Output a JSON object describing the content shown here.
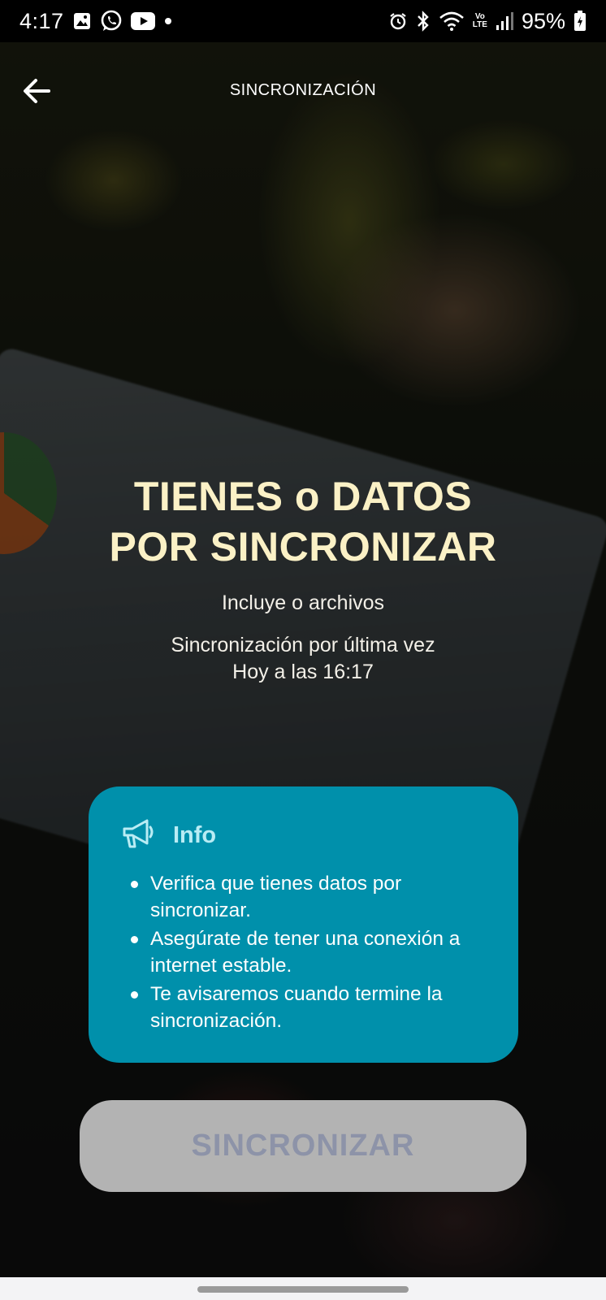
{
  "status_bar": {
    "time": "4:17",
    "battery": "95%",
    "icons_left": [
      "gallery-icon",
      "whatsapp-icon",
      "youtube-icon",
      "dot-icon"
    ],
    "icons_right": [
      "alarm-icon",
      "bluetooth-icon",
      "wifi-icon",
      "volte-icon",
      "signal-icon",
      "battery-icon"
    ],
    "volte_top": "Vo",
    "volte_bottom": "LTE"
  },
  "header": {
    "title": "SINCRONIZACIÓN",
    "back_icon": "arrow-left-icon"
  },
  "main": {
    "headline_line1": "TIENES o DATOS",
    "headline_line2": "POR SINCRONIZAR",
    "includes": "Incluye o archivos",
    "last_sync_label": "Sincronización por última vez",
    "last_sync_value": "Hoy a las 16:17"
  },
  "info_card": {
    "icon": "megaphone-icon",
    "title": "Info",
    "items": [
      "Verifica que tienes datos por sincronizar.",
      "Asegúrate de tener una conexión a internet estable.",
      "Te avisaremos cuando termine la sincronización."
    ],
    "background_color": "#0090ab"
  },
  "sync_button": {
    "label": "SINCRONIZAR",
    "state": "disabled"
  },
  "colors": {
    "headline": "#fbf1c6",
    "info_title": "#b9ecf4",
    "button_bg": "#b3b3b3",
    "button_text": "#8d93a8"
  }
}
